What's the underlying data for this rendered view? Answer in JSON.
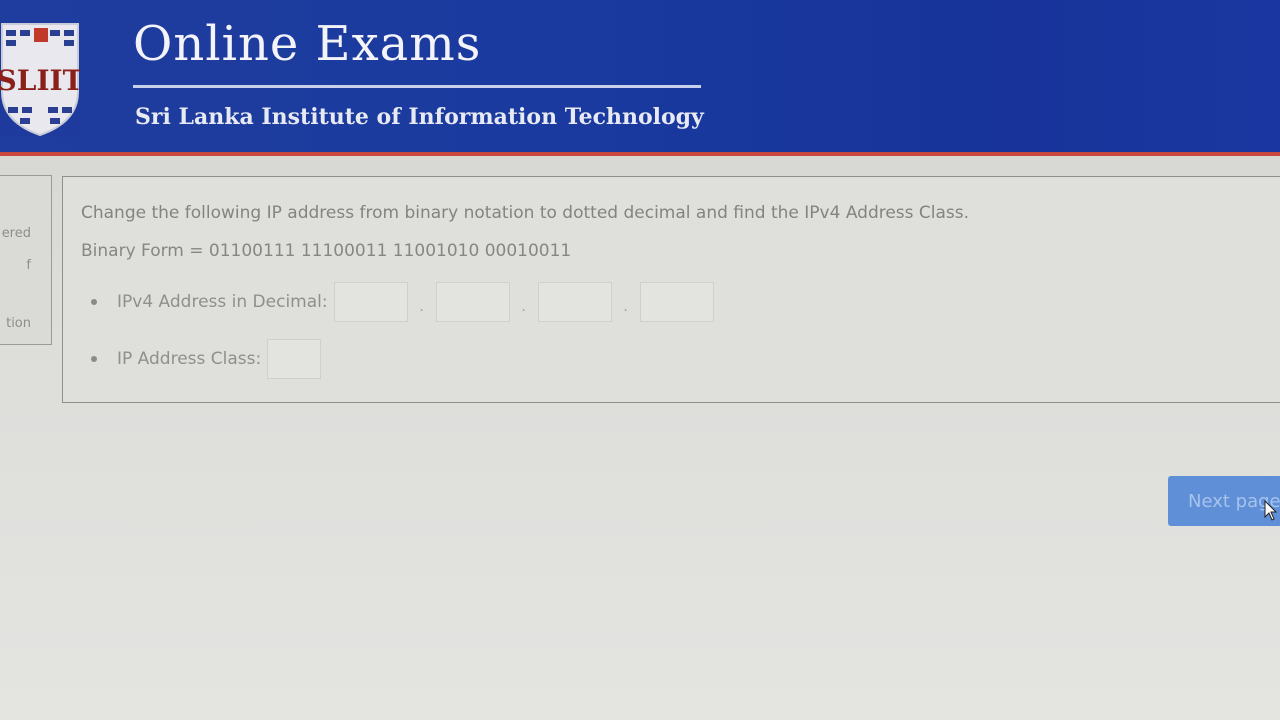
{
  "header": {
    "logo_text": "SLIIT",
    "title": "Online Exams",
    "subtitle": "Sri Lanka Institute of Information Technology"
  },
  "side_panel": {
    "line_1": "ered",
    "line_2": "f",
    "line_3": "tion"
  },
  "question": {
    "prompt": "Change the following IP address from binary notation to dotted decimal and find the IPv4 Address Class.",
    "binary_label": "Binary Form = ",
    "binary_value": "01100111 11100011 11001010 00010011",
    "decimal_label": "IPv4 Address in Decimal:",
    "octet_values": [
      "",
      "",
      "",
      ""
    ],
    "dot": ".",
    "class_label": "IP Address Class:",
    "class_value": ""
  },
  "actions": {
    "next_label": "Next page"
  },
  "colors": {
    "banner": "#1f3d9e",
    "banner_accent": "#c8483e",
    "button": "#5f8fd6"
  }
}
